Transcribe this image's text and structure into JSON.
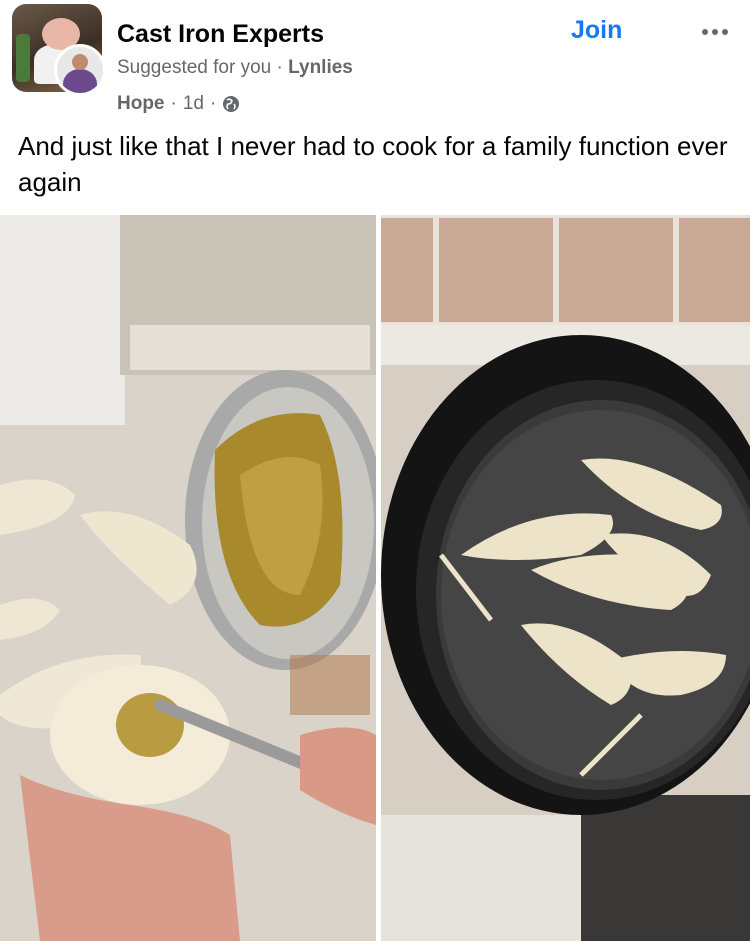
{
  "post": {
    "group_name": "Cast Iron Experts",
    "suggested_label": "Suggested for you",
    "separator": "·",
    "author": "Lynlies",
    "poster": "Hope",
    "time": "1d",
    "join_label": "Join",
    "text": "And just like that I never had to cook for a family function ever again"
  },
  "icons": {
    "group_avatar": "group-avatar-pig",
    "user_avatar": "user-avatar",
    "globe": "globe-icon",
    "more": "more-options-icon"
  },
  "colors": {
    "accent": "#1877f2",
    "secondary_text": "#65676b",
    "primary_text": "#050505"
  }
}
